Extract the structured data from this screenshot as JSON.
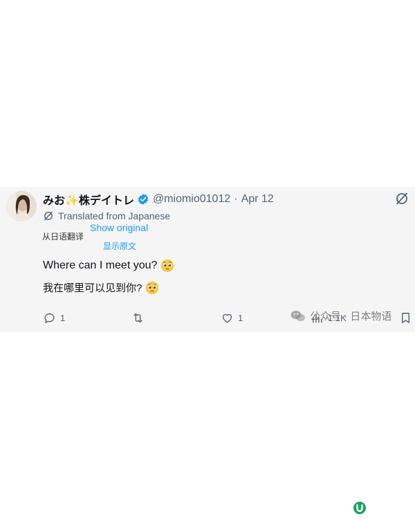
{
  "tweet": {
    "display_name": "みお✨株デイトレ",
    "handle": "@miomio01012",
    "separator": "·",
    "date": "Apr 12",
    "translated_label": "Translated from Japanese",
    "translated_label_zh": "从日语翻译",
    "show_original": "Show original",
    "show_original_zh": "显示原文",
    "text_en": "Where can I meet you?",
    "text_zh": "我在哪里可以见到你?",
    "emoji": "pleading-face",
    "reply_count": "1",
    "like_count": "1",
    "views_count": "1.1K"
  },
  "watermark": {
    "text": "公众号 · 日本物语"
  },
  "colors": {
    "link_blue": "#1d9bf0",
    "verified_blue": "#1d9bf0",
    "muted_gray": "#536471",
    "card_bg": "#f5f5f5",
    "corner_logo_green": "#1aa260"
  }
}
